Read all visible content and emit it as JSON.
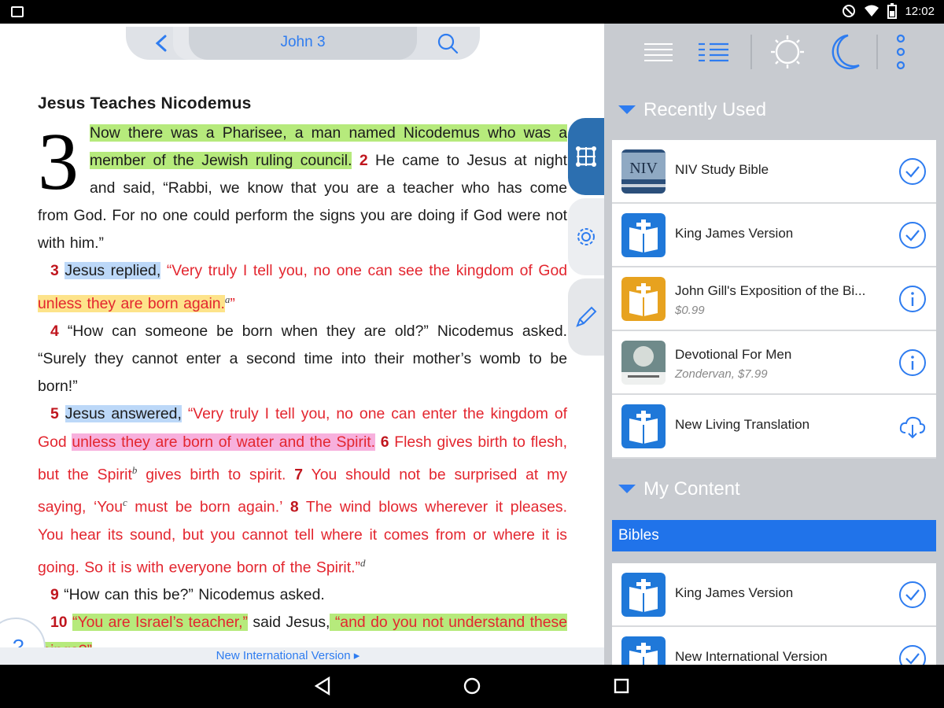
{
  "status": {
    "time": "12:02"
  },
  "reader": {
    "nav_title": "John 3",
    "heading": "Jesus Teaches Nicodemus",
    "chapter": "3",
    "p1": {
      "hl1": "Now there was a Pharisee, a man named Nicodemus who was a member of the Jewish ruling council.",
      "v2n": "2",
      "t1": " He came to Jesus at night and said, “Rabbi, we know that you are a teacher who has come from God. For no one could perform the signs you are doing if God were not with him.”"
    },
    "p2": {
      "vn": "3",
      "hl": "Jesus replied,",
      "r1": " “Very truly I tell you, no one can see the kingdom of God ",
      "hly": "unless they are born again.",
      "sup": "a",
      "r2": "”"
    },
    "p3": {
      "vn": "4",
      "t": " “How can someone be born when they are old?” Nicodemus asked. “Surely they cannot enter a second time into their mother’s womb to be born!”"
    },
    "p4": {
      "vn": "5",
      "hl": "Jesus answered,",
      "r1": " “Very truly I tell you, no one can enter the kingdom of God ",
      "hlp": "unless they are born of water and the Spirit.",
      "v6": " 6",
      "r2": " Flesh gives birth to flesh, but the Spirit",
      "supb": "b",
      "r3": " gives birth to spirit.",
      "v7": " 7",
      "r4": " You should not be surprised at my saying, ‘You",
      "supc": "c",
      "r5": " must be born again.’",
      "v8": " 8",
      "r6": " The wind blows wherever it pleases. You hear its sound, but you cannot tell where it comes from or where it is going. So it is with everyone born of the Spirit.”",
      "supd": "d"
    },
    "p5": {
      "vn": "9",
      "t": " “How can this be?” Nicodemus asked."
    },
    "p6": {
      "vn": "10",
      "hl1": "“You are Israel’s teacher,”",
      "t": " said Jesus,",
      "hl2": " “and do you not understand these things?”"
    },
    "help_label": "?",
    "version_label": "New International Version ▸"
  },
  "panel": {
    "recently_used_label": "Recently Used",
    "recent": [
      {
        "title": "NIV Study Bible",
        "sub": "",
        "action": "check-icon",
        "thumb": "niv-cover"
      },
      {
        "title": "King James Version",
        "sub": "",
        "action": "check-icon",
        "thumb": "bible-app-icon"
      },
      {
        "title": "John Gill's Exposition of the Bi...",
        "sub": "$0.99",
        "action": "info-icon",
        "thumb": "bible-app-icon-gold"
      },
      {
        "title": "Devotional For Men",
        "sub": "Zondervan, $7.99",
        "action": "info-icon",
        "thumb": "devotional-cover"
      },
      {
        "title": "New Living Translation",
        "sub": "",
        "action": "cloud-download-icon",
        "thumb": "bible-app-icon"
      }
    ],
    "my_content_label": "My Content",
    "bibles_label": "Bibles",
    "bibles": [
      {
        "title": "King James Version",
        "action": "check-icon",
        "thumb": "bible-app-icon"
      },
      {
        "title": "New International Version",
        "action": "check-icon",
        "thumb": "bible-app-icon"
      }
    ]
  },
  "colors": {
    "accent": "#2e7cf0",
    "verse_number": "#c0161e",
    "words_of_christ": "#e3262f"
  }
}
